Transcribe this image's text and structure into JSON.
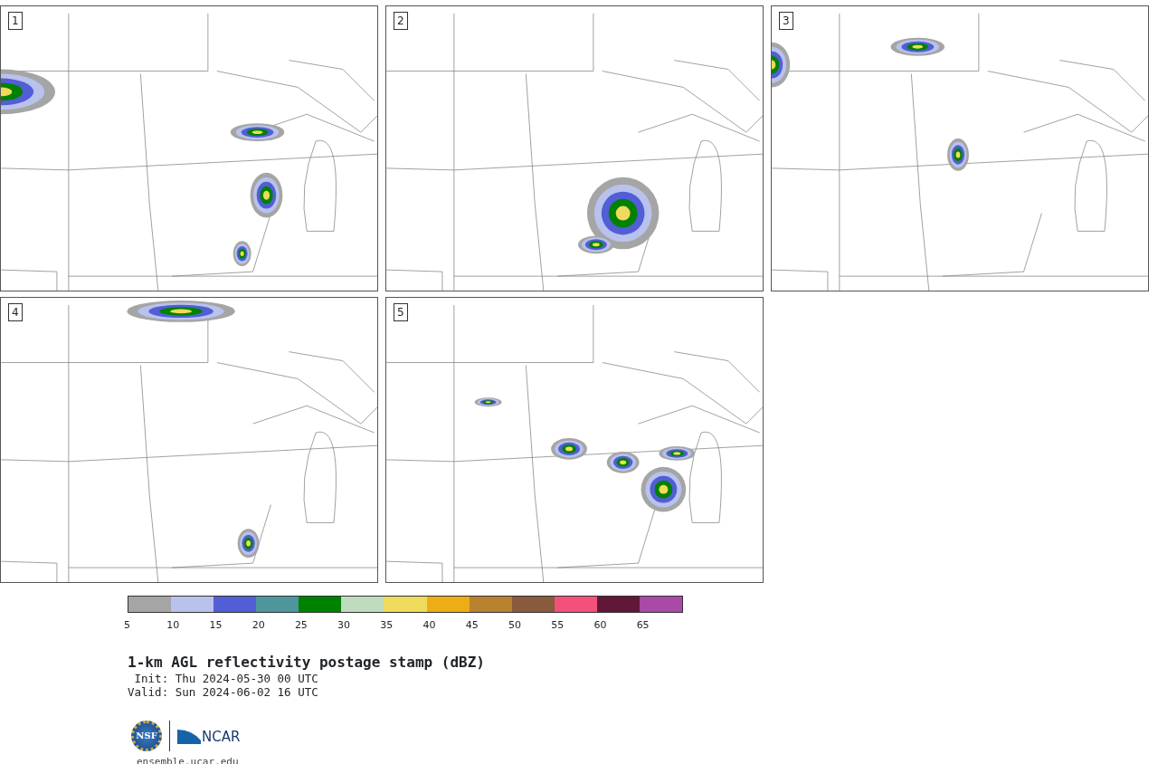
{
  "panels": [
    {
      "number": "1"
    },
    {
      "number": "2"
    },
    {
      "number": "3"
    },
    {
      "number": "4"
    },
    {
      "number": "5"
    }
  ],
  "colorbar": {
    "segments": [
      {
        "color": "#a5a5a5"
      },
      {
        "color": "#b8c2ec"
      },
      {
        "color": "#525ed6"
      },
      {
        "color": "#4f969c"
      },
      {
        "color": "#008200"
      },
      {
        "color": "#bfdcbf"
      },
      {
        "color": "#efda5c"
      },
      {
        "color": "#eeac16"
      },
      {
        "color": "#b88230"
      },
      {
        "color": "#885a3e"
      },
      {
        "color": "#f4507c"
      },
      {
        "color": "#611838"
      },
      {
        "color": "#aa4aa8"
      }
    ],
    "ticks": [
      "5",
      "10",
      "15",
      "20",
      "25",
      "30",
      "35",
      "40",
      "45",
      "50",
      "55",
      "60",
      "65"
    ]
  },
  "title": "1-km AGL reflectivity postage stamp (dBZ)",
  "init": " Init: Thu 2024-05-30 00 UTC",
  "valid": "Valid: Sun 2024-06-02 16 UTC",
  "logos": {
    "nsf": "NSF",
    "ncar": "NCAR"
  },
  "url": "ensemble.ucar.edu"
}
